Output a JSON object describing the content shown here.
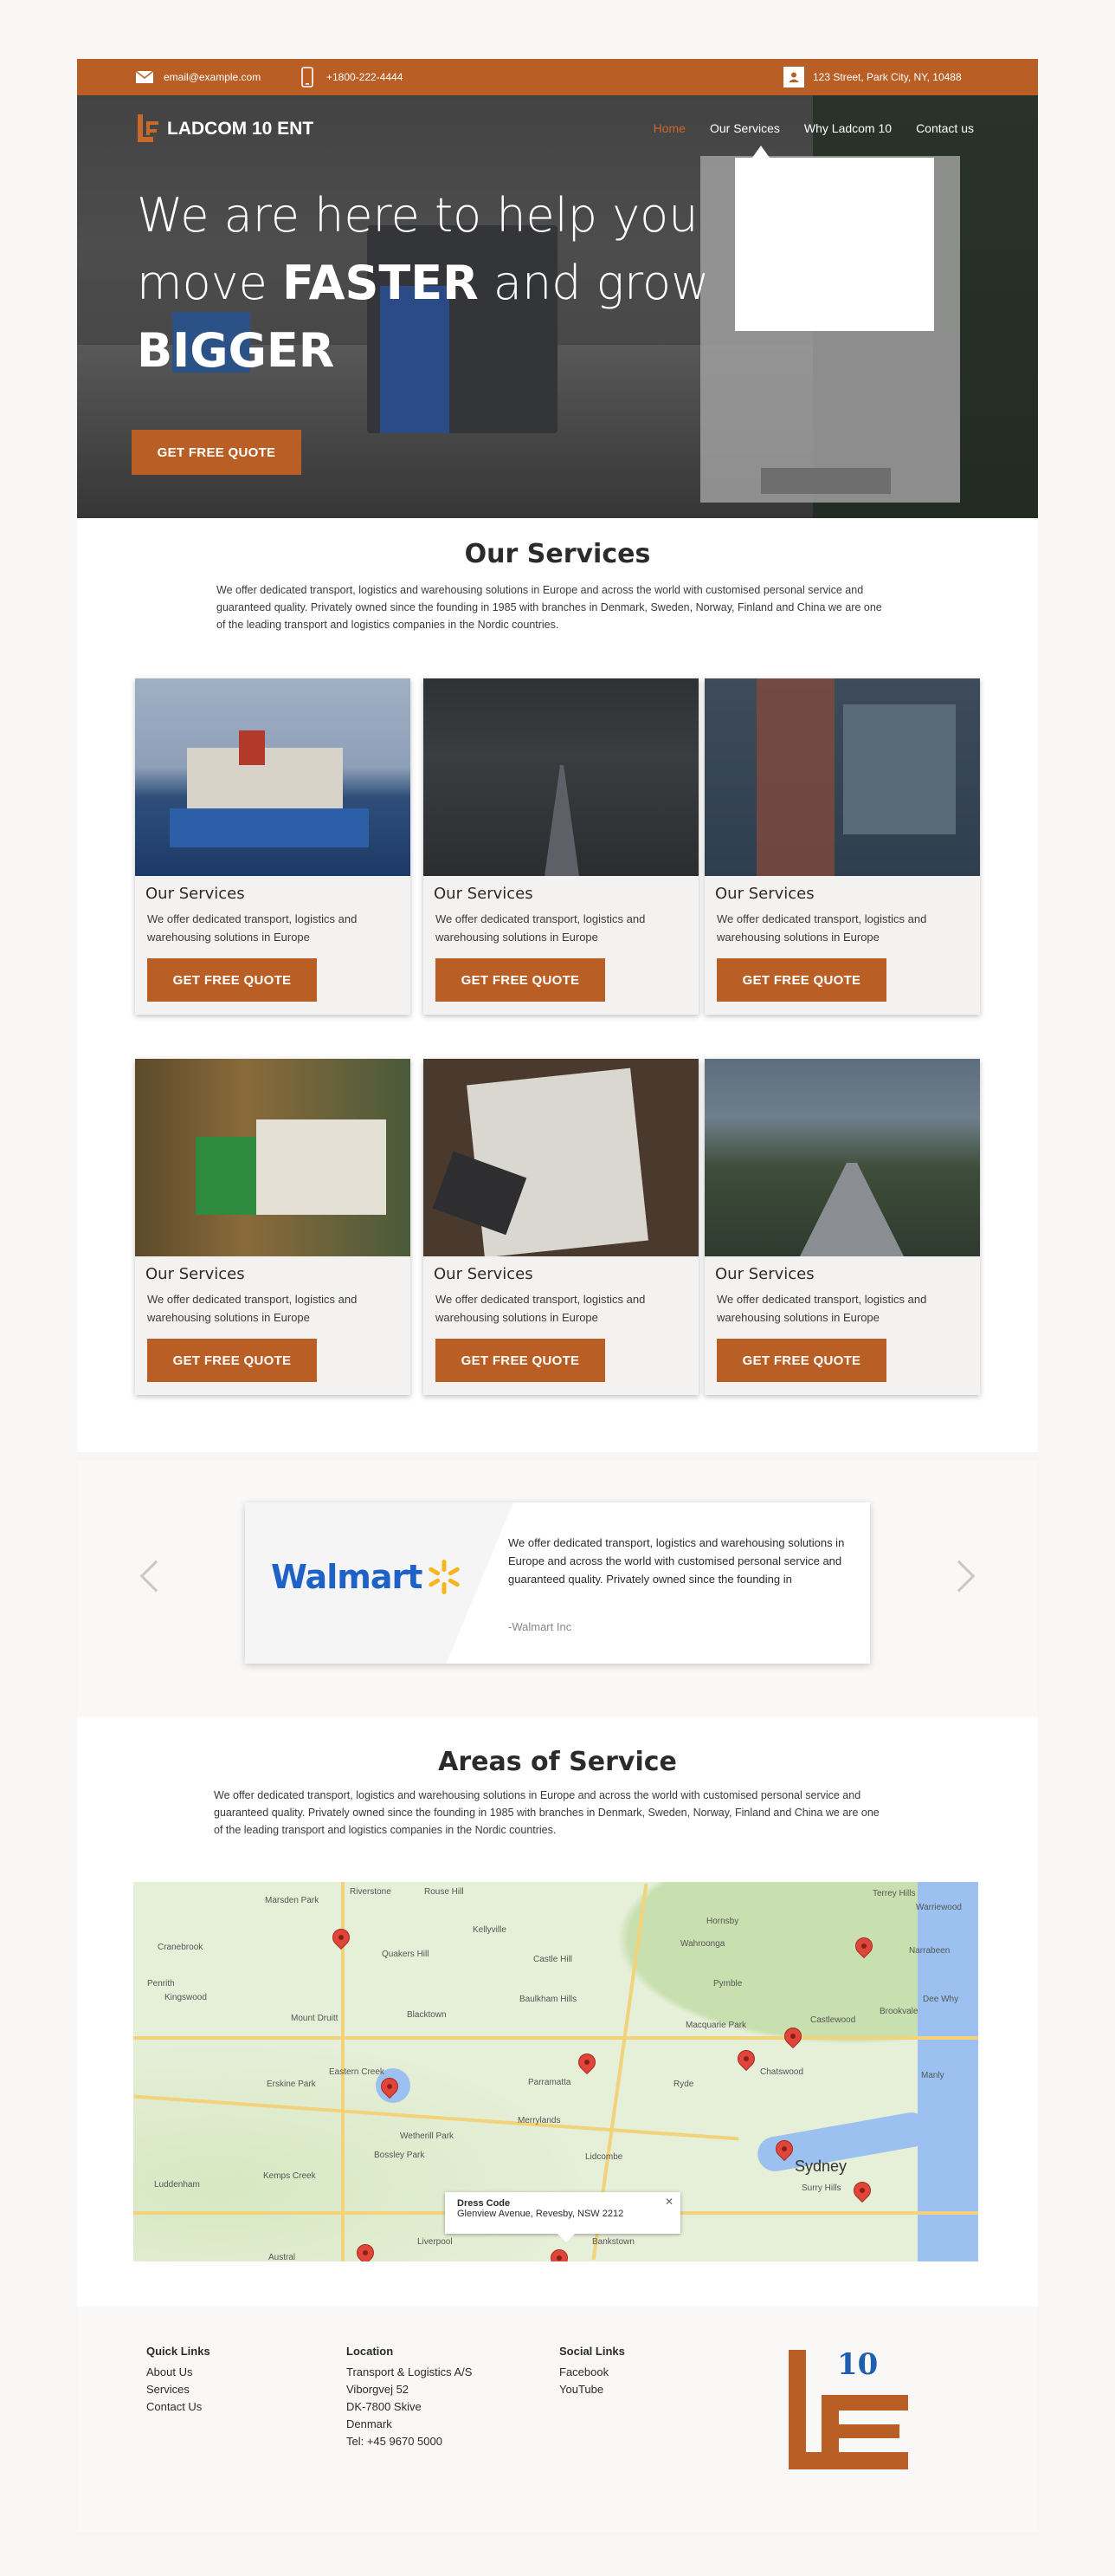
{
  "topbar": {
    "email": "email@example.com",
    "phone": "+1800-222-4444",
    "address": "123 Street, Park City, NY, 10488"
  },
  "brand": {
    "name": "LADCOM 10 ENT",
    "accent": "#b95f25"
  },
  "nav": {
    "items": [
      {
        "label": "Home"
      },
      {
        "label": "Our Services"
      },
      {
        "label": "Why Ladcom 10"
      },
      {
        "label": "Contact us"
      }
    ]
  },
  "hero": {
    "line1": "We are here to help you",
    "line2_pre": "move ",
    "line2_bold": "FASTER",
    "line2_post": " and grow",
    "line3": "BIGGER",
    "cta": "GET FREE QUOTE"
  },
  "services": {
    "title": "Our Services",
    "description": "We offer dedicated transport, logistics and warehousing solutions in Europe and across the world with customised personal service and guaranteed quality. Privately owned since the founding in 1985 with branches in Denmark, Sweden, Norway, Finland and China we are one of the leading transport and logistics companies in the Nordic countries.",
    "cards": [
      {
        "title": "Our Services",
        "text": "We offer dedicated transport, logistics and warehousing solutions in Europe",
        "button": "GET FREE QUOTE"
      },
      {
        "title": "Our Services",
        "text": "We offer dedicated transport, logistics and warehousing solutions in Europe",
        "button": "GET FREE QUOTE"
      },
      {
        "title": "Our Services",
        "text": "We offer dedicated transport, logistics and warehousing solutions in Europe",
        "button": "GET FREE QUOTE"
      },
      {
        "title": "Our Services",
        "text": "We offer dedicated transport, logistics and warehousing solutions in Europe",
        "button": "GET FREE QUOTE"
      },
      {
        "title": "Our Services",
        "text": "We offer dedicated transport, logistics and warehousing solutions in Europe",
        "button": "GET FREE QUOTE"
      },
      {
        "title": "Our Services",
        "text": "We offer dedicated transport, logistics and warehousing solutions in Europe",
        "button": "GET FREE QUOTE"
      }
    ]
  },
  "testimonial": {
    "logo_text": "Walmart",
    "quote": "We offer dedicated transport, logistics and warehousing solutions in Europe and across the world with customised personal service and guaranteed quality. Privately owned since the founding in",
    "author": "-Walmart Inc"
  },
  "areas": {
    "title": "Areas of Service",
    "description": "We offer dedicated transport, logistics and warehousing solutions in Europe and across the world with customised personal service and guaranteed quality. Privately owned since the founding in 1985 with branches in Denmark, Sweden, Norway, Finland and China we are one of the leading transport and logistics companies in the Nordic countries.",
    "map_labels": [
      "Riverstone",
      "Rouse Hill",
      "Marsden Park",
      "Cranebrook",
      "Quakers Hill",
      "Kellyville",
      "Castle Hill",
      "Hornsby",
      "Wahroonga",
      "Penrith",
      "Kingswood",
      "Mount Druitt",
      "Blacktown",
      "Baulkham Hills",
      "Pymble",
      "Macquarie Park",
      "Chatswood",
      "Eastern Creek",
      "Erskine Park",
      "Parramatta",
      "Ryde",
      "Merrylands",
      "Wetherill Park",
      "Bossley Park",
      "Lidcombe",
      "Sydney",
      "Surry Hills",
      "Luddenham",
      "Kemps Creek",
      "Liverpool",
      "Bankstown",
      "Austral",
      "Terrey Hills",
      "Warriewood",
      "Narrabeen",
      "Dee Why",
      "Brookvale",
      "Manly",
      "Castlewood"
    ],
    "info_title": "Dress Code",
    "info_address": "Glenview Avenue, Revesby, NSW 2212"
  },
  "footer": {
    "quick_links": {
      "title": "Quick Links",
      "items": [
        "About Us",
        "Services",
        "Contact Us"
      ]
    },
    "location": {
      "title": "Location",
      "lines": [
        "Transport & Logistics A/S",
        "Viborgvej 52",
        "DK-7800 Skive",
        "Denmark",
        "Tel: +45 9670 5000"
      ]
    },
    "social": {
      "title": "Social Links",
      "items": [
        "Facebook",
        "YouTube"
      ]
    },
    "logo_number": "10"
  }
}
